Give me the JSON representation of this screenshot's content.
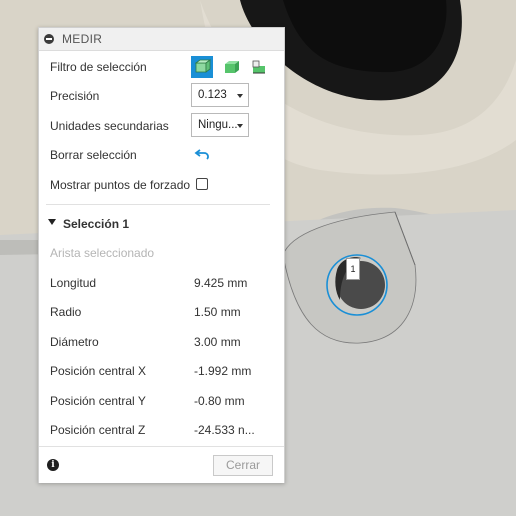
{
  "panel": {
    "title": "MEDIR",
    "filter_label": "Filtro de selección",
    "filter_icons": [
      "body-select-icon",
      "face-select-icon",
      "edge-select-icon"
    ],
    "precision_label": "Precisión",
    "precision_value": "0.123",
    "secondary_units_label": "Unidades secundarias",
    "secondary_units_value": "Ningu...",
    "clear_selection_label": "Borrar selección",
    "snap_points_label": "Mostrar puntos de forzado",
    "selection_header": "Selección 1",
    "selected_type": "Arista seleccionado",
    "measurements": [
      {
        "label": "Longitud",
        "value": "9.425 mm"
      },
      {
        "label": "Radio",
        "value": "1.50 mm"
      },
      {
        "label": "Diámetro",
        "value": "3.00 mm"
      },
      {
        "label": "Posición central X",
        "value": "-1.992 mm"
      },
      {
        "label": "Posición central Y",
        "value": "-0.80 mm"
      },
      {
        "label": "Posición central Z",
        "value": "-24.533 n..."
      }
    ],
    "close_label": "Cerrar"
  },
  "viewport": {
    "selection_tag": "1"
  },
  "colors": {
    "accent": "#1a8fd6",
    "panel_bg": "#ffffff",
    "model_gray": "#c9c9c6"
  }
}
